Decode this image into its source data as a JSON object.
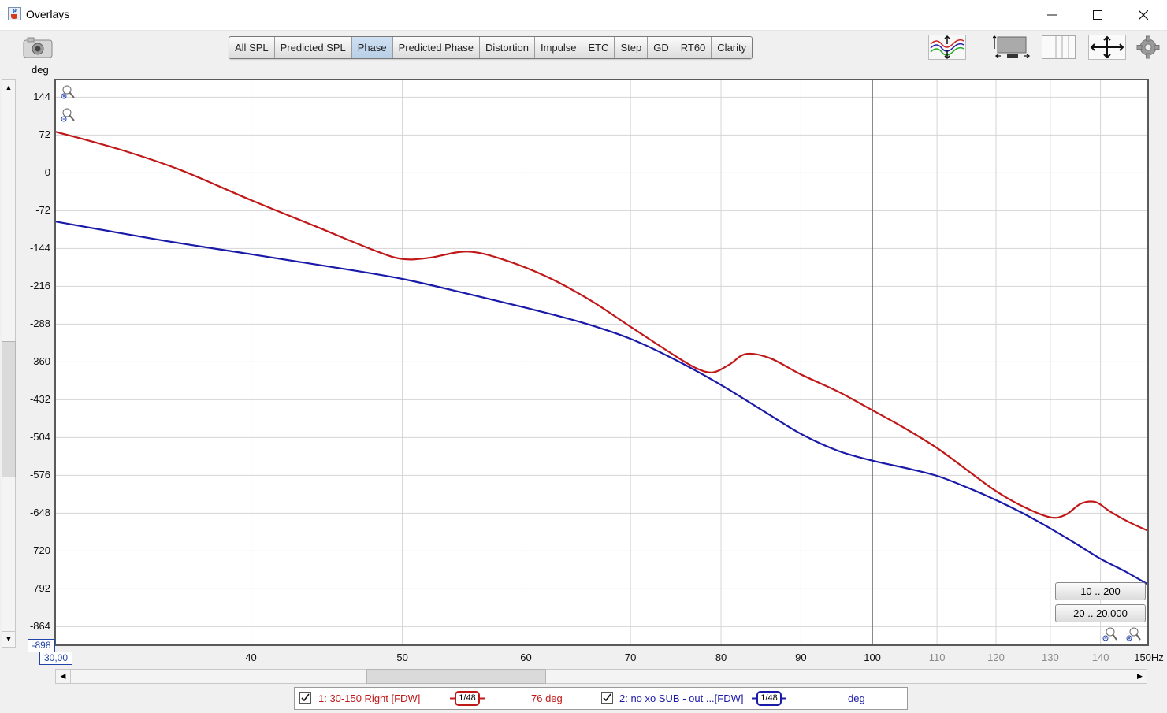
{
  "window": {
    "title": "Overlays",
    "icon": "java-cup-icon"
  },
  "toolbar": {
    "tabs": [
      "All SPL",
      "Predicted SPL",
      "Phase",
      "Predicted Phase",
      "Distortion",
      "Impulse",
      "ETC",
      "Step",
      "GD",
      "RT60",
      "Clarity"
    ],
    "active_tab": "Phase",
    "right_icons": [
      "trace-arrange-icon",
      "controls-panel-icon",
      "columns-icon",
      "move-arrows-icon",
      "gear-icon"
    ]
  },
  "plot": {
    "y_unit": "deg",
    "y_ticks": [
      "144",
      "72",
      "0",
      "-72",
      "-144",
      "-216",
      "-288",
      "-360",
      "-432",
      "-504",
      "-576",
      "-648",
      "-720",
      "-792",
      "-864"
    ],
    "y_min_box": "-898",
    "x_min_box": "30,00",
    "x_ticks": [
      "40",
      "50",
      "60",
      "70",
      "80",
      "90",
      "100",
      "110",
      "120",
      "130",
      "140"
    ],
    "x_end_label": "150Hz",
    "range_buttons": [
      "10 .. 200",
      "20 .. 20.000"
    ]
  },
  "chart_data": {
    "type": "line",
    "xscale": "log",
    "xlim": [
      30,
      150
    ],
    "ylim": [
      -898,
      176
    ],
    "xlabel": "Hz",
    "ylabel": "deg",
    "grid": true,
    "cursor_x": 100,
    "series": [
      {
        "name": "1: 30-150 Right [FDW]",
        "color": "#c01818",
        "x": [
          30,
          33,
          36,
          40,
          44,
          48,
          50,
          52,
          55,
          58,
          62,
          66,
          70,
          74,
          77,
          79,
          81,
          83,
          86,
          90,
          95,
          100,
          105,
          110,
          115,
          120,
          125,
          130,
          133,
          136,
          139,
          142,
          146,
          150
        ],
        "y": [
          78,
          44,
          6,
          -52,
          -102,
          -148,
          -164,
          -162,
          -150,
          -165,
          -199,
          -243,
          -293,
          -340,
          -371,
          -380,
          -365,
          -345,
          -353,
          -384,
          -416,
          -452,
          -487,
          -524,
          -566,
          -606,
          -636,
          -656,
          -651,
          -630,
          -627,
          -645,
          -665,
          -681
        ]
      },
      {
        "name": "2: no xo SUB - out ...[FDW]",
        "color": "#1a1aa8",
        "x": [
          30,
          35,
          40,
          45,
          50,
          55,
          60,
          65,
          70,
          75,
          80,
          85,
          90,
          95,
          100,
          105,
          110,
          115,
          120,
          125,
          130,
          135,
          140,
          145,
          150
        ],
        "y": [
          -93,
          -128,
          -155,
          -179,
          -202,
          -230,
          -257,
          -284,
          -316,
          -358,
          -404,
          -452,
          -497,
          -529,
          -548,
          -562,
          -577,
          -599,
          -623,
          -649,
          -677,
          -706,
          -735,
          -758,
          -783
        ]
      }
    ]
  },
  "legend": {
    "item1_label": "1: 30-150 Right [FDW]",
    "item1_smoothing": "1/48",
    "item1_value": "76 deg",
    "item1_color": "#c01818",
    "item2_label": "2: no xo SUB - out ...[FDW]",
    "item2_smoothing": "1/48",
    "item2_value": "deg",
    "item2_color": "#1a1aa8"
  }
}
